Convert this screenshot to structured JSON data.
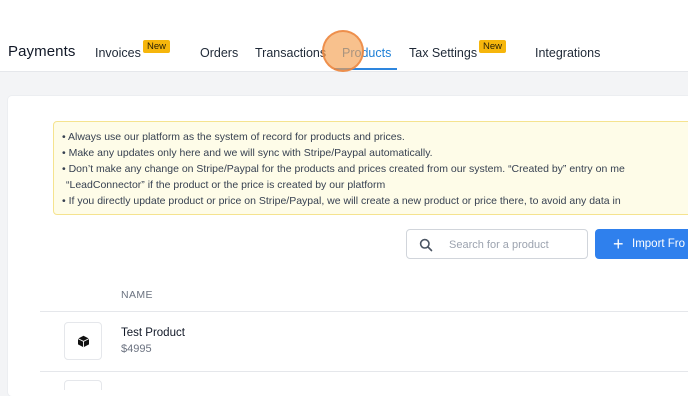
{
  "header": {
    "title": "Payments",
    "tabs": [
      {
        "label": "Invoices",
        "badge": "New",
        "active": false
      },
      {
        "label": "Orders",
        "badge": null,
        "active": false
      },
      {
        "label": "Transactions",
        "badge": null,
        "active": false
      },
      {
        "label": "Products",
        "badge": null,
        "active": true
      },
      {
        "label": "Tax Settings",
        "badge": "New",
        "active": false
      },
      {
        "label": "Integrations",
        "badge": null,
        "active": false
      }
    ]
  },
  "notice": {
    "lines": [
      "• Always use our platform as the system of record for products and prices.",
      "• Make any updates only here and we will sync with Stripe/Paypal automatically.",
      "• Don’t make any change on Stripe/Paypal for the products and prices created from our system. “Created by” entry on me",
      "  “LeadConnector” if the product or the price is created by our platform",
      "• If you directly update product or price on Stripe/Paypal, we will create a new product or price there, to avoid any data in"
    ]
  },
  "search": {
    "placeholder": "Search for a product",
    "value": ""
  },
  "import_button": {
    "label": "Import Fro"
  },
  "table": {
    "columns": [
      "NAME"
    ],
    "rows": [
      {
        "name": "Test Product",
        "price": "$4995"
      }
    ]
  },
  "colors": {
    "accent": "#2f80ed",
    "active_tab": "#1d7fd6",
    "badge": "#f6b60c",
    "notice_bg": "#fefce8"
  },
  "icons": {
    "search": "search-icon",
    "plus": "plus-icon",
    "product": "box-icon"
  }
}
